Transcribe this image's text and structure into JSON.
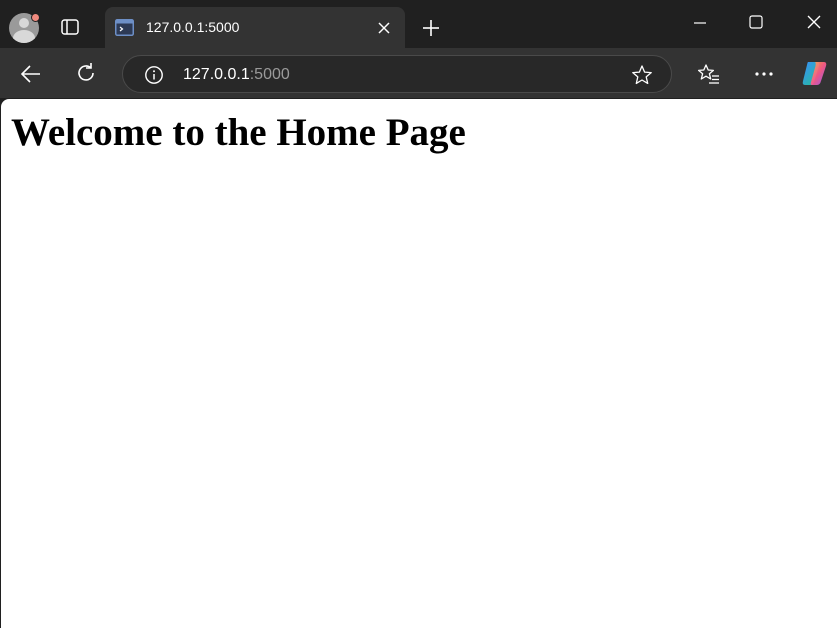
{
  "browser": {
    "tab": {
      "title": "127.0.0.1:5000"
    },
    "address_bar": {
      "host": "127.0.0.1",
      "port": ":5000"
    }
  },
  "page": {
    "heading": "Welcome to the Home Page"
  },
  "colors": {
    "titlebar": "#202020",
    "toolbar": "#333333",
    "page_background": "#ffffff",
    "profile_notification": "#f08a7e"
  },
  "icons": {
    "profile": "profile-avatar-icon",
    "workspaces": "workspaces-icon",
    "favicon": "terminal-favicon-icon",
    "tab_close": "close-icon",
    "new_tab": "plus-icon",
    "minimize": "minimize-icon",
    "maximize": "maximize-icon",
    "window_close": "close-icon",
    "back": "back-arrow-icon",
    "reload": "reload-icon",
    "site_info": "info-icon",
    "favorite": "star-icon",
    "favorites": "favorites-list-icon",
    "more": "more-dots-icon",
    "copilot": "copilot-icon"
  }
}
